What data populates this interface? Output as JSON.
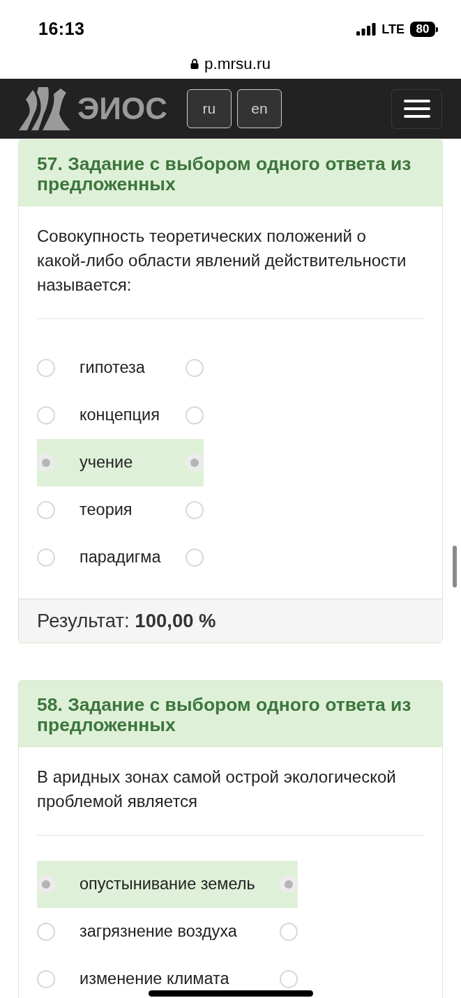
{
  "status_bar": {
    "time": "16:13",
    "network": "LTE",
    "battery": "80"
  },
  "address_bar": {
    "url": "p.mrsu.ru"
  },
  "navbar": {
    "logo_text": "ЭИОС",
    "languages": [
      {
        "label": "ru"
      },
      {
        "label": "en"
      }
    ]
  },
  "questions": [
    {
      "title": "57. Задание с выбором одного ответа из предложенных",
      "text": "Совокупность теоретических положений о какой-либо области явлений действительности называется:",
      "options": [
        {
          "label": "гипотеза",
          "selected": false
        },
        {
          "label": "концепция",
          "selected": false
        },
        {
          "label": "учение",
          "selected": true
        },
        {
          "label": "теория",
          "selected": false
        },
        {
          "label": "парадигма",
          "selected": false
        }
      ],
      "result": "Результат: **100,00 %**"
    },
    {
      "title": "58. Задание с выбором одного ответа из предложенных",
      "text": "В аридных зонах самой острой экологической проблемой является",
      "options": [
        {
          "label": "опустынивание земель",
          "selected": true
        },
        {
          "label": "загрязнение воздуха",
          "selected": false
        },
        {
          "label": "изменение климата",
          "selected": false
        }
      ]
    }
  ]
}
